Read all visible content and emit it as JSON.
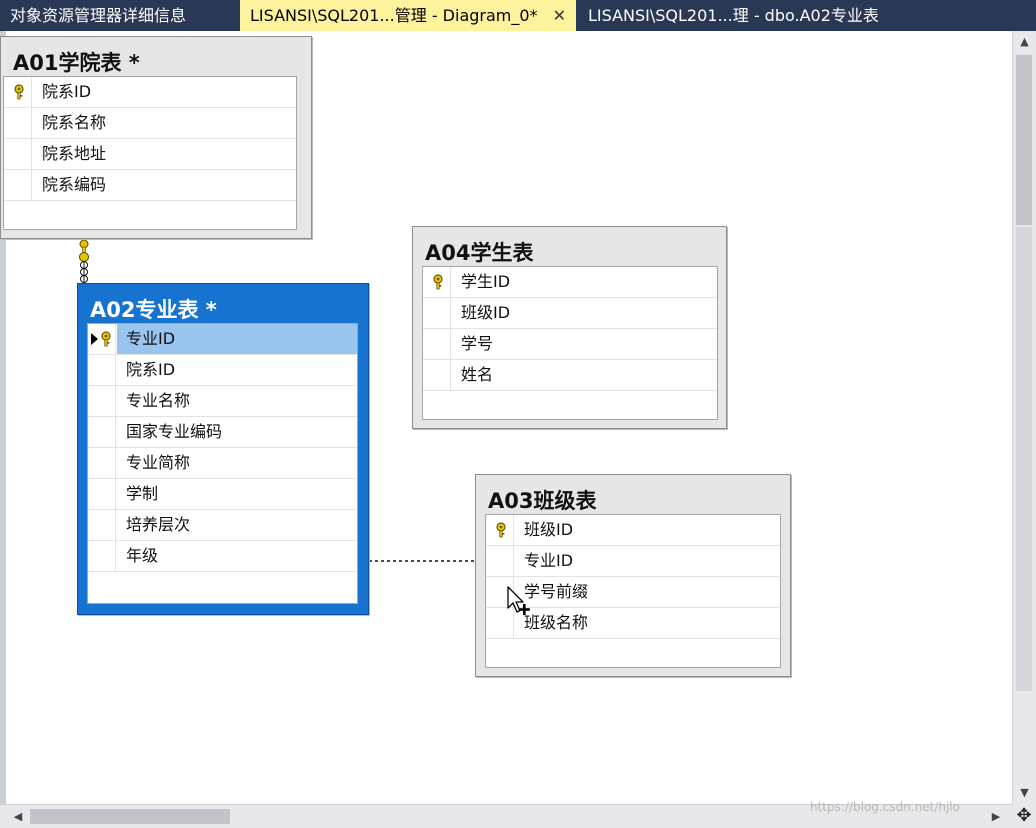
{
  "tabs": [
    {
      "label": "对象资源管理器详细信息",
      "active": false
    },
    {
      "label": "LISANSI\\SQL201...管理 - Diagram_0*",
      "active": true,
      "close": "✕"
    },
    {
      "label": "LISANSI\\SQL201...理 - dbo.A02专业表",
      "active": false
    }
  ],
  "tables": {
    "a01": {
      "title": "A01学院表 *",
      "columns": [
        {
          "name": "院系ID",
          "key": true
        },
        {
          "name": "院系名称",
          "key": false
        },
        {
          "name": "院系地址",
          "key": false
        },
        {
          "name": "院系编码",
          "key": false
        }
      ]
    },
    "a02": {
      "title": "A02专业表 *",
      "selected": true,
      "columns": [
        {
          "name": "专业ID",
          "key": true,
          "current": true
        },
        {
          "name": "院系ID",
          "key": false
        },
        {
          "name": "专业名称",
          "key": false
        },
        {
          "name": "国家专业编码",
          "key": false
        },
        {
          "name": "专业简称",
          "key": false
        },
        {
          "name": "学制",
          "key": false
        },
        {
          "name": "培养层次",
          "key": false
        },
        {
          "name": "年级",
          "key": false
        }
      ]
    },
    "a04": {
      "title": "A04学生表",
      "columns": [
        {
          "name": "学生ID",
          "key": true
        },
        {
          "name": "班级ID",
          "key": false
        },
        {
          "name": "学号",
          "key": false
        },
        {
          "name": "姓名",
          "key": false
        }
      ]
    },
    "a03": {
      "title": "A03班级表",
      "columns": [
        {
          "name": "班级ID",
          "key": true
        },
        {
          "name": "专业ID",
          "key": false
        },
        {
          "name": "学号前缀",
          "key": false
        },
        {
          "name": "班级名称",
          "key": false
        }
      ]
    }
  },
  "watermark": "https://blog.csdn.net/hjlo",
  "colors": {
    "tab_strip": "#293955",
    "active_tab": "#fff29d",
    "selected_table": "#1674d0",
    "selected_row": "#99c4ee"
  },
  "icons": {
    "key": "key-icon",
    "row_selector": "row-selector-arrow-icon",
    "cursor": "move-cursor-icon",
    "pan": "pan-icon"
  }
}
